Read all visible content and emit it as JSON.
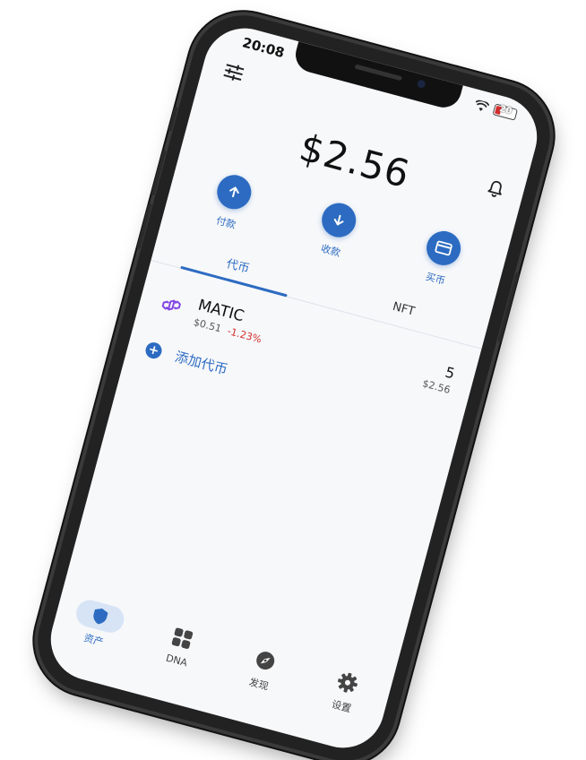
{
  "status_bar": {
    "time": "20:08",
    "battery_level": "20",
    "battery_color": "#d32f2f"
  },
  "header": {
    "left_icon": "settings-sliders-icon",
    "right_icon": "bell-icon"
  },
  "balance": {
    "total": "$2.56"
  },
  "actions": [
    {
      "label": "付款",
      "icon": "arrow-up-icon"
    },
    {
      "label": "收款",
      "icon": "arrow-down-icon"
    },
    {
      "label": "买币",
      "icon": "card-icon"
    }
  ],
  "tabs": [
    {
      "label": "代币",
      "active": true
    },
    {
      "label": "NFT",
      "active": false
    }
  ],
  "tokens": [
    {
      "icon": "polygon-logo-icon",
      "name": "MATIC",
      "price": "$0.51",
      "change": "-1.23%",
      "amount": "5",
      "value": "$2.56"
    }
  ],
  "add_token": {
    "label": "添加代币"
  },
  "bottom_nav": [
    {
      "label": "资产",
      "icon": "shield-icon",
      "active": true
    },
    {
      "label": "DNA",
      "icon": "grid-icon",
      "active": false
    },
    {
      "label": "发现",
      "icon": "compass-icon",
      "active": false
    },
    {
      "label": "设置",
      "icon": "gear-icon",
      "active": false
    }
  ],
  "colors": {
    "accent": "#2c6bc1",
    "negative": "#d32f2f",
    "nav_active_bg": "#d7e4f6",
    "polygon_purple": "#8247e5"
  }
}
